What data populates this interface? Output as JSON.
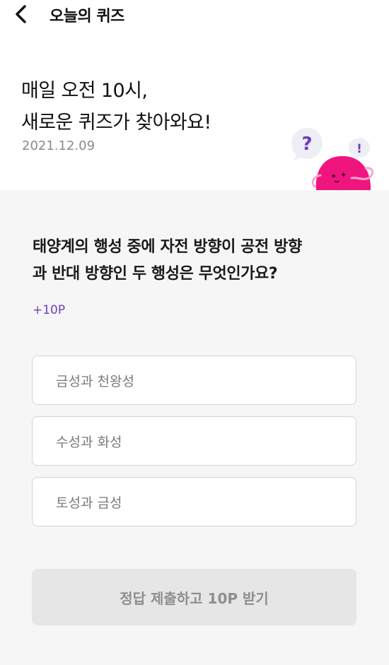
{
  "header": {
    "back_icon": "chevron-left-icon",
    "title": "오늘의 퀴즈"
  },
  "hero": {
    "line1": "매일 오전 10시,",
    "line2": "새로운 퀴즈가 찾아와요!",
    "date": "2021.12.09",
    "mascot": {
      "question_mark": "?",
      "exclamation_mark": "!",
      "colors": {
        "body": "#f0157e",
        "bubble": "#eeeef6",
        "question": "#6c3fb9"
      }
    }
  },
  "quiz": {
    "question_line1": "태양계의 행성 중에 자전 방향이 공전 방향",
    "question_line2": "과 반대 방향인 두 행성은 무엇인가요?",
    "points": "+10P",
    "options": [
      {
        "label": "금성과 천왕성"
      },
      {
        "label": "수성과 화성"
      },
      {
        "label": "토성과 금성"
      }
    ],
    "submit_label": "정답 제출하고 10P 받기"
  },
  "colors": {
    "accent": "#6c3fb9",
    "background": "#f6f6f6",
    "button_disabled": "#e6e6e6"
  }
}
